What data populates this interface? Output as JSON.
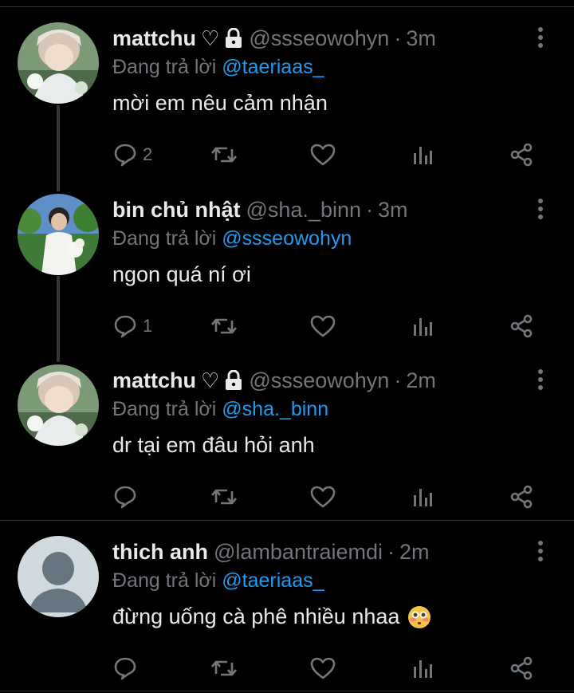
{
  "reply_prefix": "Đang trả lời",
  "tweets": [
    {
      "name": "mattchu",
      "heart": "♡",
      "lock_icon": "lock-icon",
      "handle": "@ssseowohyn",
      "time": "3m",
      "reply_to": "@taeriaas_",
      "text": "mời em nêu cảm nhận",
      "reply_count": "2"
    },
    {
      "name": "bin chủ nhật",
      "handle": "@sha._binn",
      "time": "3m",
      "reply_to": "@ssseowohyn",
      "text": "ngon quá ní ơi",
      "reply_count": "1"
    },
    {
      "name": "mattchu",
      "heart": "♡",
      "lock_icon": "lock-icon",
      "handle": "@ssseowohyn",
      "time": "2m",
      "reply_to": "@sha._binn",
      "text": "dr tại em đâu hỏi anh",
      "reply_count": ""
    },
    {
      "name": "thich anh",
      "handle": "@lambantraiemdi",
      "time": "2m",
      "reply_to": "@taeriaas_",
      "text": "đừng uống cà phê nhiều nhaa",
      "emoji_icon": "flushed-face-icon",
      "reply_count": ""
    }
  ],
  "colors": {
    "background": "#000000",
    "text": "#e7e9ea",
    "muted": "#71767b",
    "accent": "#1d9bf0",
    "divider": "#2f3336"
  }
}
